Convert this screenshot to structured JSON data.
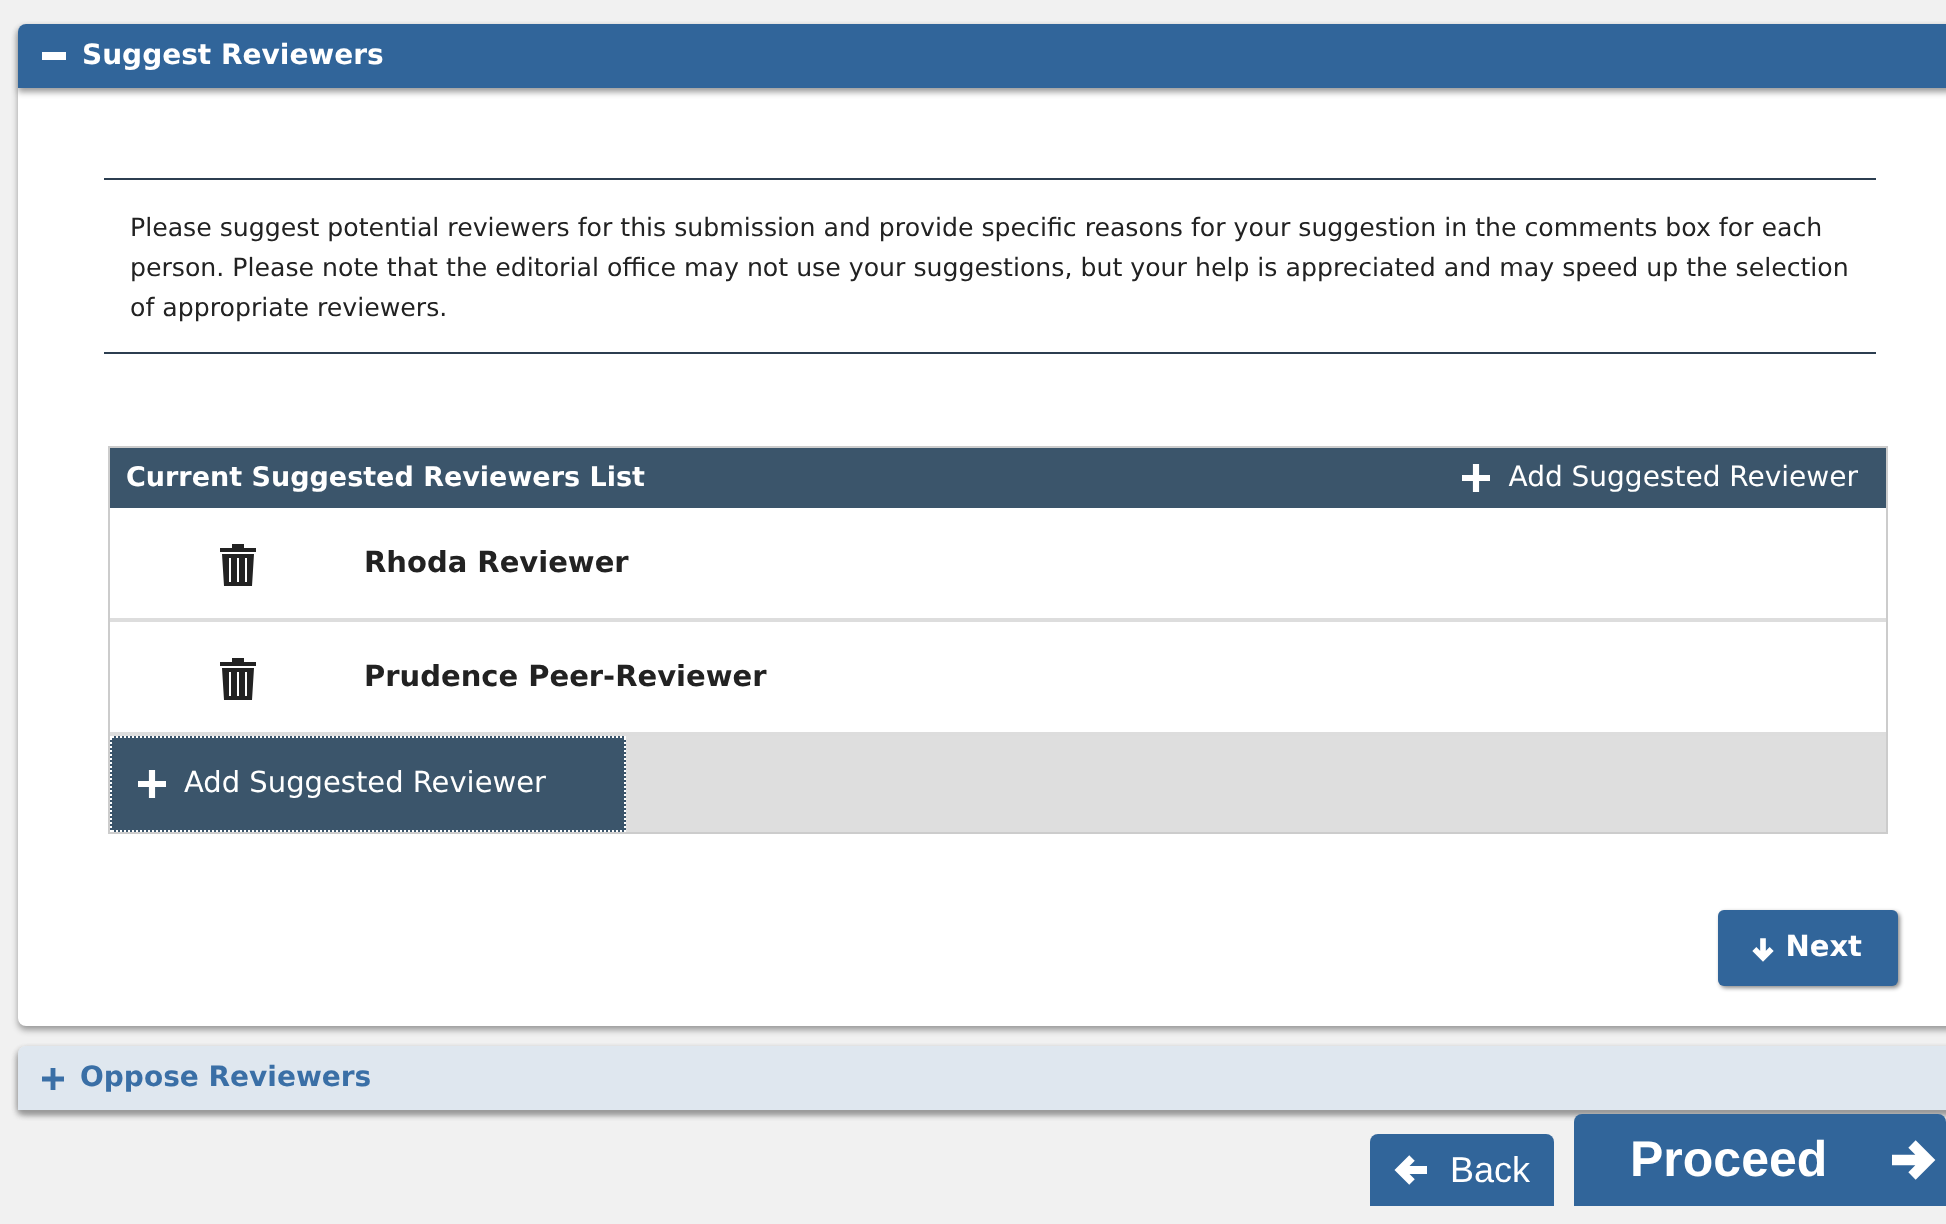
{
  "sections": [
    {
      "title": "Suggest Reviewers",
      "expanded": true,
      "intro": "Please suggest potential reviewers for this submission and provide specific reasons for your suggestion in the comments box for each person. Please note that the editorial office may not use your suggestions, but your help is appreciated and may speed up the selection of appropriate reviewers.",
      "list": {
        "title": "Current Suggested Reviewers List",
        "header_action": "Add Suggested Reviewer",
        "reviewers": [
          {
            "name": "Rhoda Reviewer"
          },
          {
            "name": "Prudence Peer-Reviewer"
          }
        ],
        "footer_action": "Add Suggested Reviewer",
        "footer_focused": true
      },
      "next_button": "Next"
    },
    {
      "title": "Oppose Reviewers",
      "expanded": false
    }
  ],
  "nav": {
    "back": "Back",
    "proceed": "Proceed"
  }
}
